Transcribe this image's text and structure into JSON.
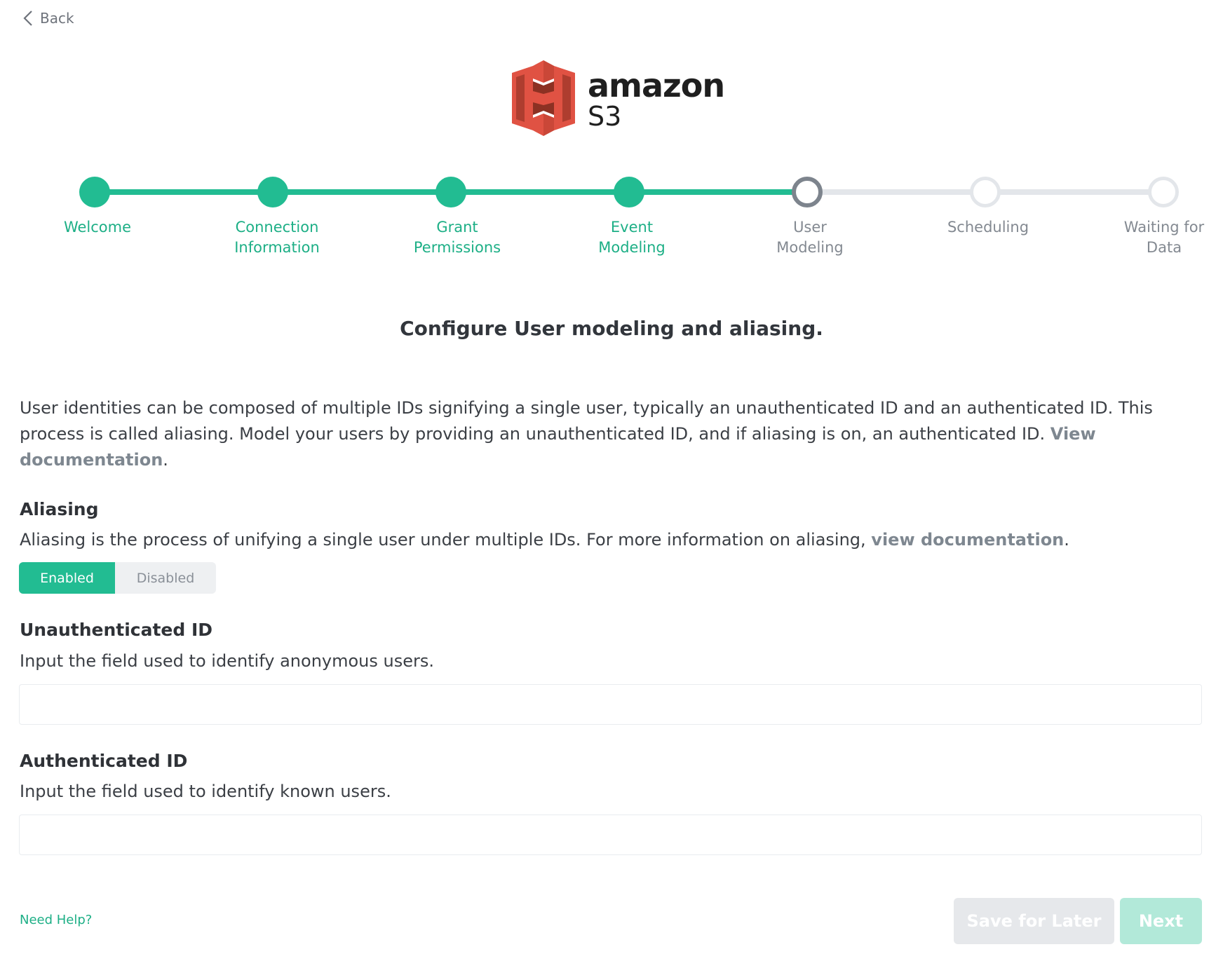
{
  "nav": {
    "back_label": "Back"
  },
  "logo": {
    "brand": "amazon",
    "product": "S3"
  },
  "colors": {
    "accent": "#22bc92",
    "pending": "#e3e6ea",
    "current": "#7d848d"
  },
  "steps": [
    {
      "label": "Welcome",
      "state": "done"
    },
    {
      "label": "Connection\nInformation",
      "state": "done"
    },
    {
      "label": "Grant\nPermissions",
      "state": "done"
    },
    {
      "label": "Event\nModeling",
      "state": "done"
    },
    {
      "label": "User\nModeling",
      "state": "current"
    },
    {
      "label": "Scheduling",
      "state": "todo"
    },
    {
      "label": "Waiting for\nData",
      "state": "todo"
    }
  ],
  "page": {
    "heading": "Configure User modeling and aliasing.",
    "intro_text": "User identities can be composed of multiple IDs signifying a single user, typically an unauthenticated ID and an authenticated ID. This process is called aliasing. Model your users by providing an unauthenticated ID, and if aliasing is on, an authenticated ID.",
    "intro_link": "View documentation",
    "intro_end": "."
  },
  "aliasing": {
    "title": "Aliasing",
    "desc_text": "Aliasing is the process of unifying a single user under multiple IDs. For more information on aliasing, ",
    "desc_link": "view documentation",
    "desc_end": ".",
    "toggle": {
      "enabled_label": "Enabled",
      "disabled_label": "Disabled",
      "selected": "Enabled"
    }
  },
  "unauthenticated": {
    "title": "Unauthenticated ID",
    "desc": "Input the field used to identify anonymous users.",
    "value": ""
  },
  "authenticated": {
    "title": "Authenticated ID",
    "desc": "Input the field used to identify known users.",
    "value": ""
  },
  "footer": {
    "help_label": "Need Help?",
    "save_label": "Save for Later",
    "next_label": "Next"
  }
}
